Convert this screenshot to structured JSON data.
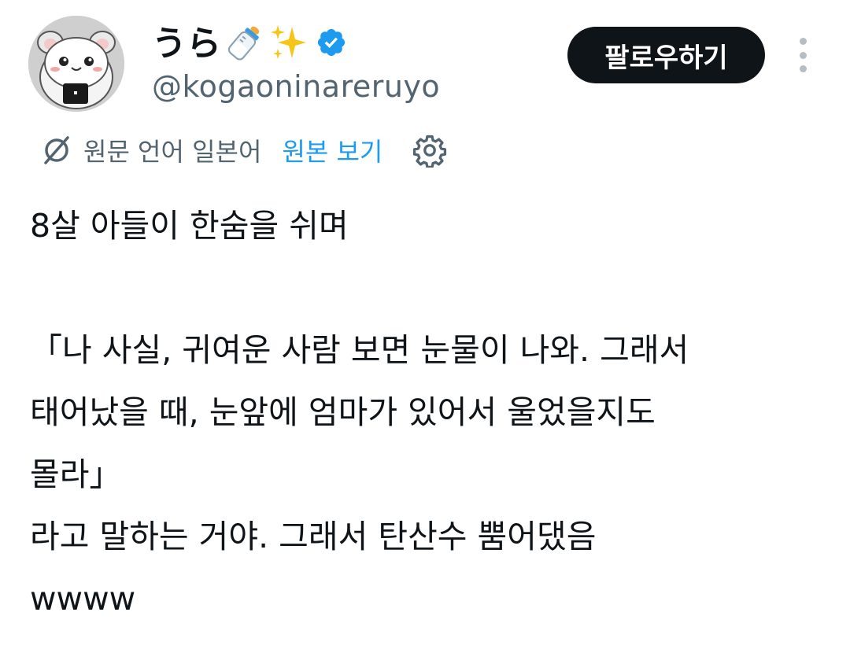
{
  "user": {
    "display_name": "うら",
    "display_emojis": [
      "baby-bottle-icon",
      "sparkles-icon"
    ],
    "verified": true,
    "handle": "@kogaoninareruyo"
  },
  "actions": {
    "follow_label": "팔로우하기",
    "more_icon": "more-vertical-icon"
  },
  "translation": {
    "icon": "translate-icon",
    "source_text": "원문 언어 일본어",
    "view_original_label": "원본 보기",
    "settings_icon": "gear-icon"
  },
  "tweet": {
    "lines": [
      "8살 아들이 한숨을 쉬며",
      "",
      "「나 사실, 귀여운 사람 보면 눈물이 나와. 그래서",
      "태어났을 때, 눈앞에 엄마가 있어서 울었을지도",
      "몰라」",
      "라고 말하는 거야. 그래서 탄산수 뿜어댔음",
      "wwww"
    ]
  },
  "colors": {
    "text": "#0f1419",
    "secondary": "#536471",
    "link": "#1d9bf0",
    "verified": "#1d9bf0",
    "button_bg": "#0f1419"
  }
}
